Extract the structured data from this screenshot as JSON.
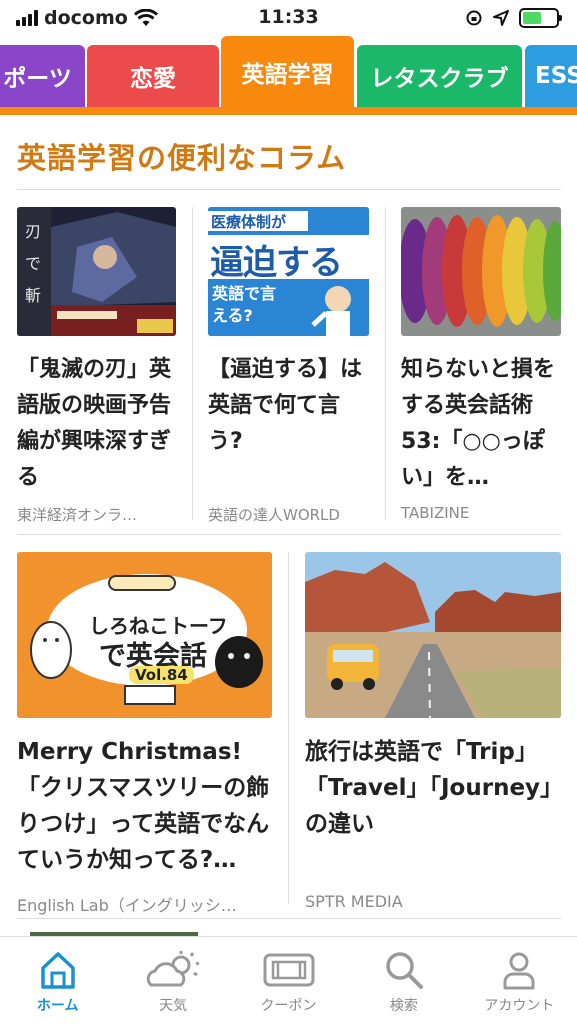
{
  "status_bar": {
    "carrier": "docomo",
    "time": "11:33"
  },
  "tabs": [
    {
      "label": "ポーツ",
      "color": "#8b45c9"
    },
    {
      "label": "恋愛",
      "color": "#ec4b4b"
    },
    {
      "label": "英語学習",
      "color": "#f6890e",
      "active": true
    },
    {
      "label": "レタスクラブ",
      "color": "#1bb86a"
    },
    {
      "label": "ESS",
      "color": "#2e9de0"
    }
  ],
  "section": {
    "title": "英語学習の便利なコラム"
  },
  "articles": [
    {
      "title": "「鬼滅の刃」英語版の映画予告編が興味深すぎる",
      "source": "東洋経済オンラ…"
    },
    {
      "title": "【逼迫する】は英語で何て言う?",
      "source": "英語の達人WORLD",
      "thumb_text": {
        "top": "医療体制が",
        "main": "逼迫する",
        "sub": "英語で言える?"
      }
    },
    {
      "title": "知らないと損をする英会話術53:「○○っぽい」を…",
      "source": "TABIZINE"
    },
    {
      "title": "Merry Christmas!「クリスマスツリーの飾りつけ」って英語でなんていうか知ってる?…",
      "source": "English Lab（イングリッシ…",
      "thumb_text": {
        "line1": "しろねこトーフ",
        "line2": "で英会話",
        "vol": "Vol.84"
      }
    },
    {
      "title": "旅行は英語で「Trip」「Travel」「Journey」の違い",
      "source": "SPTR MEDIA"
    }
  ],
  "bottom_nav": [
    {
      "label": "ホーム",
      "icon": "home-icon",
      "active": true
    },
    {
      "label": "天気",
      "icon": "weather-icon"
    },
    {
      "label": "クーポン",
      "icon": "coupon-icon"
    },
    {
      "label": "検索",
      "icon": "search-icon"
    },
    {
      "label": "アカウント",
      "icon": "account-icon"
    }
  ],
  "colors": {
    "accent": "#f6890e",
    "section_title": "#cf7a12",
    "nav_active": "#1a8fd6"
  }
}
